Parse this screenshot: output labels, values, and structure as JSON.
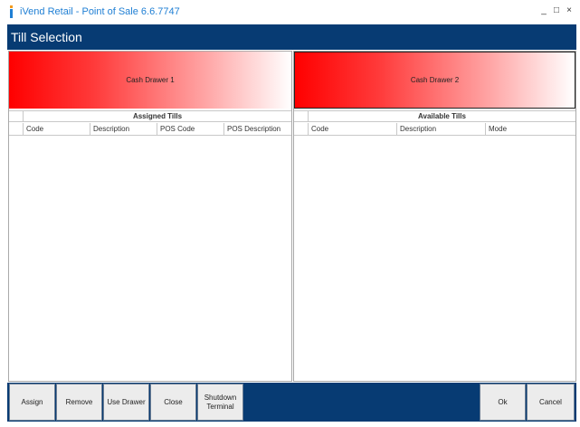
{
  "window": {
    "title": "iVend Retail - Point of Sale 6.6.7747",
    "minimize": "_",
    "maximize": "□",
    "close": "×"
  },
  "header": {
    "title": "Till Selection"
  },
  "left_panel": {
    "drawer_label": "Cash Drawer 1",
    "group_title": "Assigned Tills",
    "columns": [
      "Code",
      "Description",
      "POS Code",
      "POS Description"
    ]
  },
  "right_panel": {
    "drawer_label": "Cash Drawer 2",
    "group_title": "Available Tills",
    "columns": [
      "Code",
      "Description",
      "Mode"
    ]
  },
  "footer": {
    "assign": "Assign",
    "remove": "Remove",
    "use_drawer": "Use Drawer",
    "close": "Close",
    "shutdown_line1": "Shutdown",
    "shutdown_line2": "Terminal",
    "ok": "Ok",
    "cancel": "Cancel"
  },
  "colors": {
    "brand_blue": "#073b73",
    "title_blue": "#1f7fd4",
    "drawer_red": "#ff0000"
  }
}
